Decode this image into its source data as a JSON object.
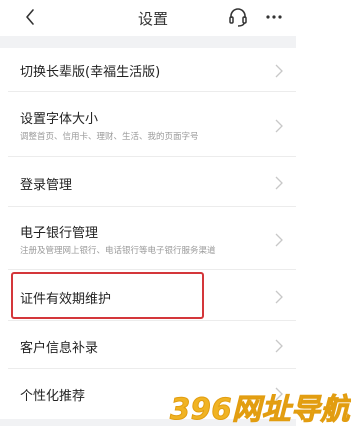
{
  "header": {
    "title": "设置",
    "back_icon": "chevron-left-icon",
    "service_icon": "headset-icon",
    "more_icon": "more-dots-icon"
  },
  "settings": [
    {
      "label": "切换长辈版(幸福生活版)",
      "sub": ""
    },
    {
      "label": "设置字体大小",
      "sub": "调整首页、信用卡、理财、生活、我的页面字号"
    },
    {
      "label": "登录管理",
      "sub": ""
    },
    {
      "label": "电子银行管理",
      "sub": "注册及管理网上银行、电话银行等电子银行服务渠道"
    },
    {
      "label": "证件有效期维护",
      "sub": ""
    },
    {
      "label": "客户信息补录",
      "sub": ""
    },
    {
      "label": "个性化推荐",
      "sub": ""
    }
  ],
  "watermark": "396网址导航",
  "colors": {
    "highlight": "#d4363a",
    "background_gap": "#f1f2f4",
    "watermark": "#f0b323"
  }
}
